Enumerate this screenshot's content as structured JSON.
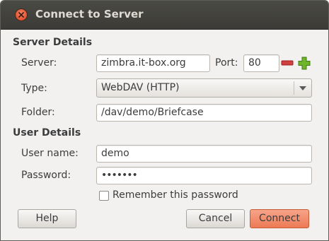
{
  "window": {
    "title": "Connect to Server"
  },
  "server_details": {
    "heading": "Server Details",
    "server_label": "Server:",
    "server_value": "zimbra.it-box.org",
    "port_label": "Port:",
    "port_value": "80",
    "type_label": "Type:",
    "type_value": "WebDAV (HTTP)",
    "folder_label": "Folder:",
    "folder_value": "/dav/demo/Briefcase"
  },
  "user_details": {
    "heading": "User Details",
    "username_label": "User name:",
    "username_value": "demo",
    "password_label": "Password:",
    "password_value": "•••••••",
    "remember_label": "Remember this password",
    "remember_checked": false
  },
  "buttons": {
    "help": "Help",
    "cancel": "Cancel",
    "connect": "Connect"
  },
  "icons": {
    "close": "close-icon",
    "decrement": "minus-icon",
    "increment": "plus-icon",
    "dropdown": "chevron-down-icon"
  },
  "colors": {
    "titlebar": "#3c3b37",
    "close_button": "#e0532f",
    "minus_button": "#d13f3f",
    "plus_button": "#6fb52c",
    "default_button": "#ec7a55"
  }
}
